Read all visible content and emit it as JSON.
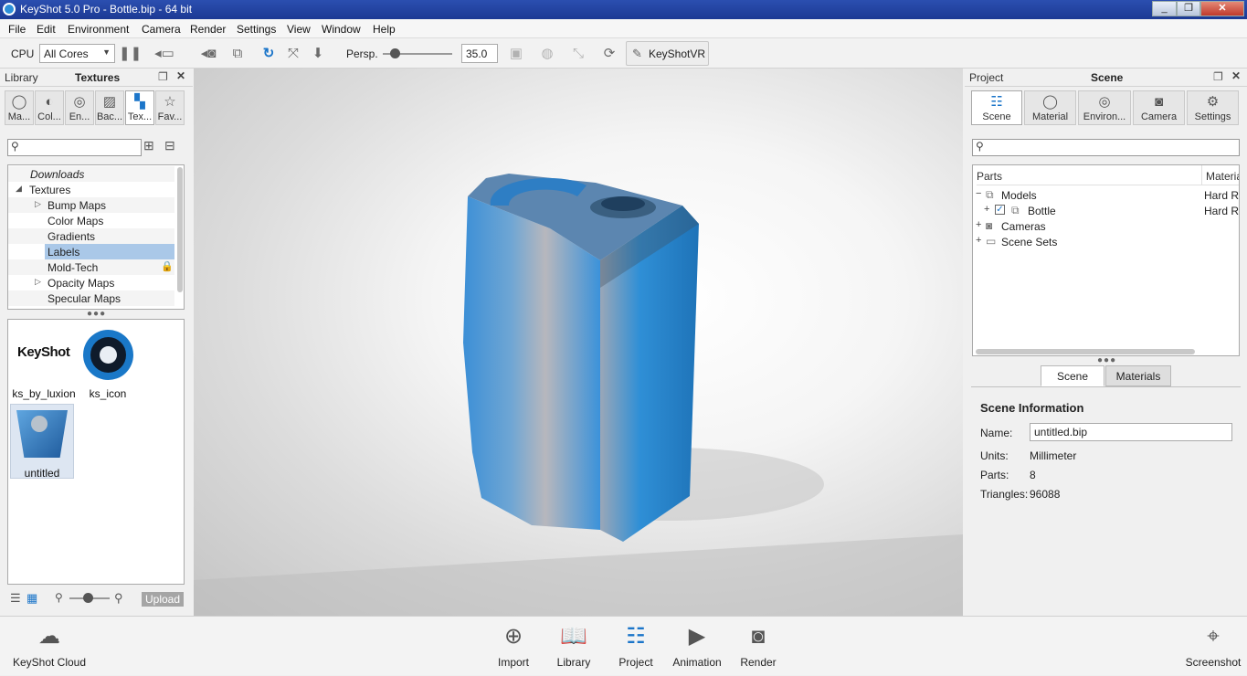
{
  "window": {
    "title": "KeyShot 5.0 Pro  - Bottle.bip  - 64 bit",
    "min": "_",
    "max": "❐",
    "close": "✕"
  },
  "menu": [
    "File",
    "Edit",
    "Environment",
    "Camera",
    "Render",
    "Settings",
    "View",
    "Window",
    "Help"
  ],
  "toolbar": {
    "cpu_label": "CPU",
    "cores_value": "All Cores",
    "persp_label": "Persp.",
    "fov_value": "35.0",
    "keyshotvr_label": "KeyShotVR"
  },
  "library": {
    "header_left": "Library",
    "header_title": "Textures",
    "tabs": [
      "Ma...",
      "Col...",
      "En...",
      "Bac...",
      "Tex...",
      "Fav..."
    ],
    "tree": [
      {
        "label": "Downloads"
      },
      {
        "label": "Textures"
      },
      {
        "label": "Bump Maps"
      },
      {
        "label": "Color Maps"
      },
      {
        "label": "Gradients"
      },
      {
        "label": "Labels"
      },
      {
        "label": "Mold-Tech"
      },
      {
        "label": "Opacity Maps"
      },
      {
        "label": "Specular Maps"
      }
    ],
    "files": [
      {
        "name": "ks_by_luxion",
        "logo_text": "KeyShot"
      },
      {
        "name": "ks_icon"
      },
      {
        "name": "untitled"
      }
    ],
    "upload_label": "Upload"
  },
  "project": {
    "header_left": "Project",
    "header_title": "Scene",
    "tabs": [
      "Scene",
      "Material",
      "Environ...",
      "Camera",
      "Settings"
    ],
    "tree_columns": [
      "Parts",
      "Materia"
    ],
    "tree": [
      {
        "label": "Models",
        "material": "Hard Ro"
      },
      {
        "label": "Bottle",
        "material": "Hard Ro"
      },
      {
        "label": "Cameras",
        "material": ""
      },
      {
        "label": "Scene Sets",
        "material": ""
      }
    ],
    "subtabs": [
      "Scene",
      "Materials"
    ],
    "info": {
      "heading": "Scene Information",
      "name_label": "Name:",
      "name_value": "untitled.bip",
      "units_label": "Units:",
      "units_value": "Millimeter",
      "parts_label": "Parts:",
      "parts_value": "8",
      "triangles_label": "Triangles:",
      "triangles_value": "96088"
    }
  },
  "bottombar": {
    "cloud": "KeyShot Cloud",
    "import": "Import",
    "library": "Library",
    "project": "Project",
    "animation": "Animation",
    "render": "Render",
    "screenshot": "Screenshot"
  },
  "colors": {
    "accent": "#1b75c9",
    "titlebar": "#1c3a94",
    "selection": "#aac8e8",
    "bottle": "#2f8fd6"
  }
}
